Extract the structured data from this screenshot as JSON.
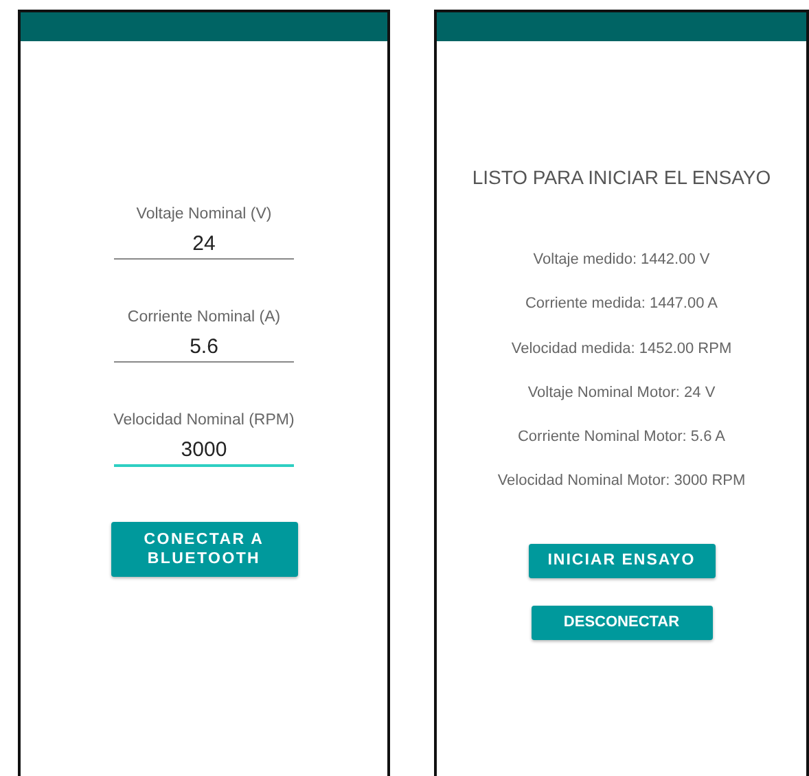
{
  "setup_screen": {
    "fields": [
      {
        "label": "Voltaje Nominal (V)",
        "value": "24",
        "focused": false
      },
      {
        "label": "Corriente Nominal (A)",
        "value": "5.6",
        "focused": false
      },
      {
        "label": "Velocidad Nominal (RPM)",
        "value": "3000",
        "focused": true
      }
    ],
    "button": "CONECTAR A BLUETOOTH"
  },
  "test_screen": {
    "title": "LISTO PARA INICIAR EL ENSAYO",
    "readings": [
      "Voltaje medido: 1442.00 V",
      "Corriente medida: 1447.00 A",
      "Velocidad medida: 1452.00 RPM",
      "Voltaje Nominal Motor: 24 V",
      "Corriente Nominal Motor: 5.6 A",
      "Velocidad Nominal Motor: 3000 RPM"
    ],
    "buttons": [
      {
        "label": "INICIAR ENSAYO",
        "kind": "primary"
      },
      {
        "label": "DESCONECTAR",
        "kind": "secondary"
      }
    ]
  }
}
